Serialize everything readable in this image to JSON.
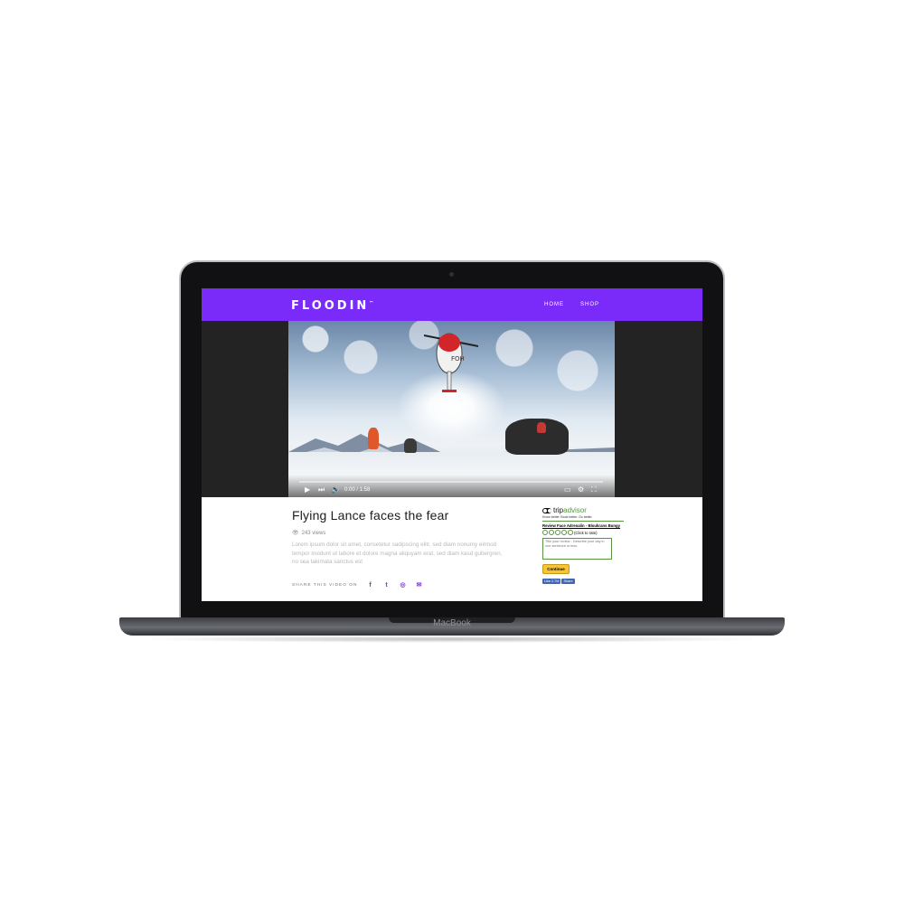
{
  "device": {
    "brand_label": "MacBook"
  },
  "header": {
    "logo": "FLOODIN",
    "logo_mark": "™",
    "nav": [
      "HOME",
      "SHOP"
    ]
  },
  "video": {
    "time": "0:00 / 1:58",
    "progress": 0
  },
  "article": {
    "title": "Flying Lance faces the fear",
    "views": "243 views",
    "description": "Lorem ipsum dolor sit amet, consetetur sadipscing elitr, sed diam nonumy eirmod tempor invidunt ut labore et dolore magna aliquyam erat, sed diam kasd gubergren, no sea takimata sanctus est",
    "share_label": "SHARE THIS VIDEO ON",
    "share_icons": [
      "facebook-icon",
      "twitter-icon",
      "instagram-icon",
      "email-icon"
    ]
  },
  "tripadvisor": {
    "logo_trip": "trip",
    "logo_advisor": "advisor",
    "tagline": "Know better. Book better. Go better.",
    "review_title": "Review Face Adrenalin - Bloukrans Bungy",
    "rating_hint": "(Click to rate)",
    "placeholder": "Title your review - Describe your day in one sentence or less.",
    "button": "Continue",
    "fb_like": "Like 2.7M",
    "fb_share": "Share"
  },
  "colors": {
    "accent": "#7b2bf9",
    "tripadvisor_green": "#589442",
    "button_yellow": "#f7c436"
  }
}
